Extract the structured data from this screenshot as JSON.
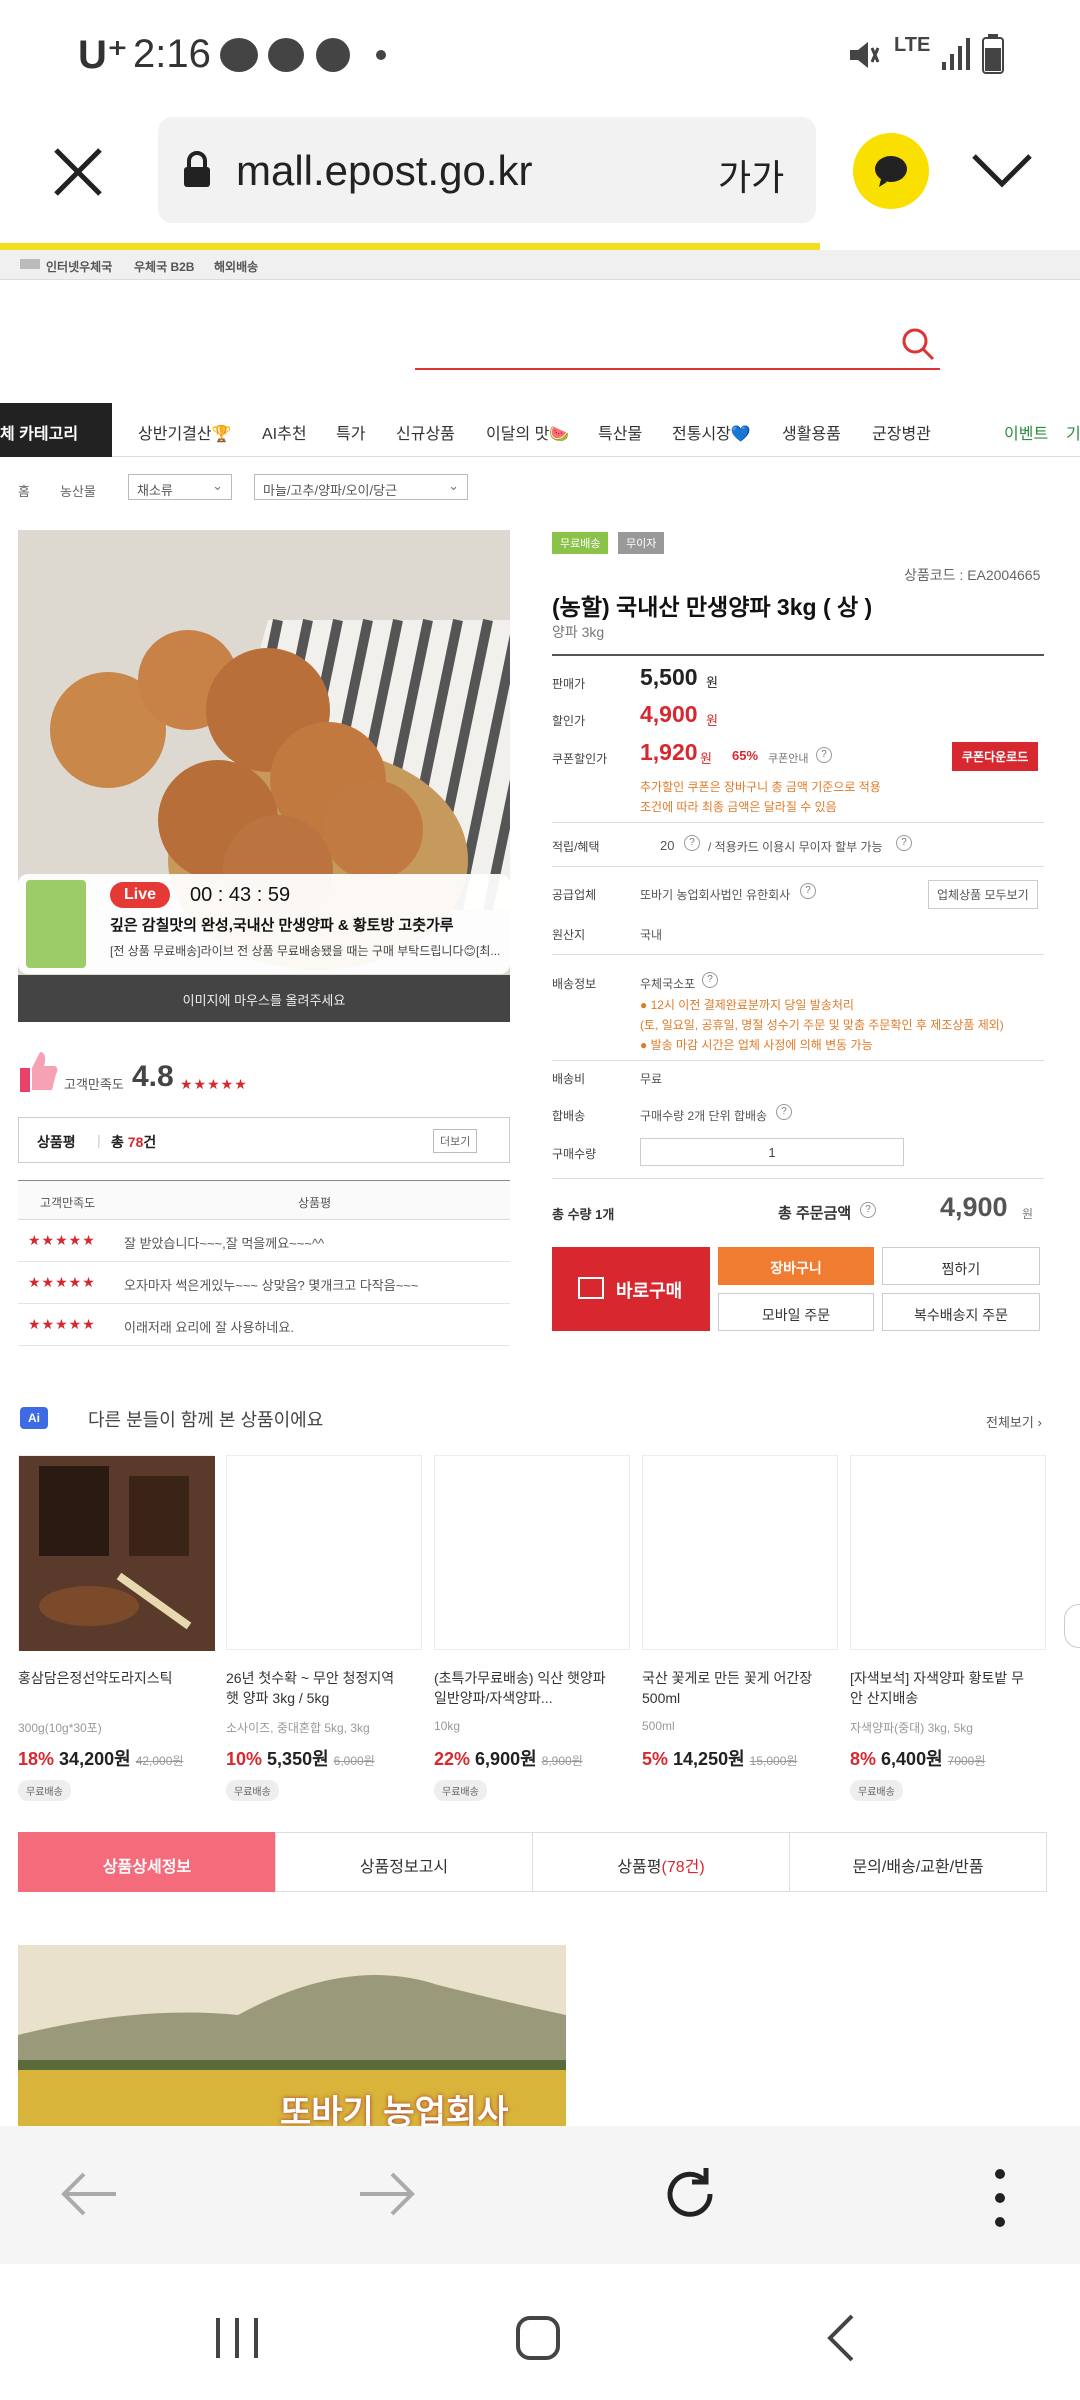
{
  "status_bar": {
    "carrier": "U⁺",
    "time": "2:16",
    "network": "LTE"
  },
  "browser": {
    "url": "mall.epost.go.kr",
    "text_size_label": "가가"
  },
  "util_bar": {
    "links": [
      "인터넷우체국",
      "우체국 B2B",
      "해외배송"
    ]
  },
  "nav": {
    "category_button": "체 카테고리",
    "items": [
      "상반기결산🏆",
      "AI추천",
      "특가",
      "신규상품",
      "이달의 맛🍉",
      "특산물",
      "전통시장💙",
      "생활용품",
      "군장병관"
    ],
    "event": "이벤트",
    "event_cut": "기"
  },
  "breadcrumb": {
    "home": "홈",
    "level1": "농산물",
    "level2": "채소류",
    "level3": "마늘/고추/양파/오이/당근"
  },
  "product_image": {
    "live_label": "Live",
    "live_timer": "00 : 43 : 59",
    "live_title": "깊은 감칠맛의 완성,국내산 만생양파 & 황토방 고춧가루",
    "live_desc": "[전 상품 무료배송]라이브 전 상품 무료배송됐을 때는 구매 부탁드립니다😊[최...",
    "hover_hint": "이미지에 마우스를 올려주세요"
  },
  "rating": {
    "label": "고객만족도",
    "score": "4.8",
    "stars": "★★★★★"
  },
  "reviews": {
    "header_label": "상품평",
    "total_prefix": "총",
    "total_count": "78",
    "total_suffix": "건",
    "more_button": "더보기",
    "col_satisfaction": "고객만족도",
    "col_review": "상품평",
    "rows": [
      {
        "stars": "★★★★★",
        "text": "잘 받았습니다~~~,잘 먹을께요~~~^^"
      },
      {
        "stars": "★★★★★",
        "text": "오자마자 썩은게있누~~~ 상맞음? 몇개크고 다작음~~~"
      },
      {
        "stars": "★★★★★",
        "text": "이래저래 요리에 잘 사용하네요."
      }
    ]
  },
  "product": {
    "badge_free_shipping": "무료배송",
    "badge_interest_free": "무이자",
    "code": "상품코드 : EA2004665",
    "title": "(농할) 국내산 만생양파 3kg ( 상 )",
    "subtitle": "양파 3kg",
    "price_label": "판매가",
    "price": "5,500",
    "discount_label": "할인가",
    "discount_price": "4,900",
    "coupon_label": "쿠폰할인가",
    "coupon_price": "1,920",
    "coupon_rate": "65%",
    "coupon_info": "쿠폰안내",
    "coupon_download": "쿠폰다운로드",
    "coupon_note1": "추가할인 쿠폰은 장바구니 총 금액 기준으로 적용",
    "coupon_note2": "조건에 따라 최종 금액은 달라질 수 있음",
    "won": "원",
    "points_label": "적립/혜택",
    "points_value": "20",
    "points_extra": "적용카드 이용시 무이자 할부 가능",
    "supplier_label": "공급업체",
    "supplier_value": "또바기 농업회사법인 유한회사",
    "supplier_button": "업체상품 모두보기",
    "origin_label": "원산지",
    "origin_value": "국내",
    "delivery_label": "배송정보",
    "delivery_value": "우체국소포",
    "delivery_note1": "● 12시 이전 결제완료분까지 당일 발송처리",
    "delivery_note2": "(토, 일요일, 공휴일, 명절 성수기 주문 및 맞춤 주문확인 후 제조상품 제외)",
    "delivery_note3": "● 발송 마감 시간은 업체 사정에 의해 변동 가능",
    "shipping_fee_label": "배송비",
    "shipping_fee_value": "무료",
    "bundle_label": "합배송",
    "bundle_value": "구매수량 2개 단위 합배송",
    "qty_label": "구매수량",
    "qty_value": "1",
    "total_qty": "총 수량 1개",
    "total_label": "총 주문금액",
    "total_price": "4,900",
    "buy_now": "바로구매",
    "cart": "장바구니",
    "wishlist": "찜하기",
    "mobile_order": "모바일 주문",
    "multi_ship": "복수배송지 주문"
  },
  "recommend": {
    "ai_badge": "Ai",
    "title": "다른 분들이 함께 본 상품이에요",
    "see_all": "전체보기 ›",
    "items": [
      {
        "title": "홍삼담은정선약도라지스틱",
        "title2": "",
        "sub": "300g(10g*30포)",
        "rate": "18%",
        "price": "34,200원",
        "orig": "42,000원",
        "badge": "무료배송"
      },
      {
        "title": "26년 첫수확 ~ 무안 청정지역",
        "title2": "햇 양파 3kg / 5kg",
        "sub": "소사이즈, 중대혼합 5kg, 3kg",
        "rate": "10%",
        "price": "5,350원",
        "orig": "6,000원",
        "badge": "무료배송"
      },
      {
        "title": "(초특가무료배송) 익산 햇양파",
        "title2": "일반양파/자색양파...",
        "sub": "10kg",
        "rate": "22%",
        "price": "6,900원",
        "orig": "8,900원",
        "badge": "무료배송"
      },
      {
        "title": "국산 꽃게로 만든 꽃게 어간장",
        "title2": "500ml",
        "sub": "500ml",
        "rate": "5%",
        "price": "14,250원",
        "orig": "15,000원",
        "badge": ""
      },
      {
        "title": "[자색보석] 자색양파 황토밭 무",
        "title2": "안 산지배송",
        "sub": "자색양파(중대) 3kg, 5kg",
        "rate": "8%",
        "price": "6,400원",
        "orig": "7000원",
        "badge": "무료배송"
      }
    ]
  },
  "detail_tabs": [
    "상품상세정보",
    "상품정보고시",
    "상품평",
    "문의/배송/교환/반품"
  ],
  "detail_tab_review_count": "(78건)",
  "banner_text": "또바기 농업회사"
}
